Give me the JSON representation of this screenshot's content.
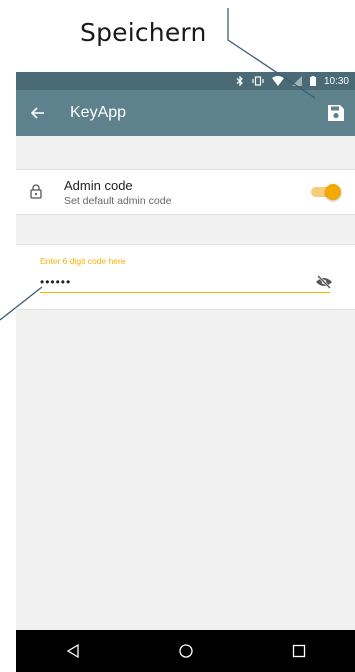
{
  "annotation": {
    "label": "Speichern"
  },
  "statusbar": {
    "time": "10:30",
    "icons": [
      "bluetooth-icon",
      "vibrate-icon",
      "wifi-icon",
      "signal-icon",
      "battery-icon"
    ]
  },
  "appbar": {
    "title": "KeyApp",
    "back_icon": "arrow-left-icon",
    "save_icon": "save-icon"
  },
  "admin_code": {
    "title": "Admin code",
    "subtitle": "Set default admin code",
    "toggle_on": true,
    "icon": "lock-icon"
  },
  "code_field": {
    "label": "Enter 6 digit code here",
    "value": "••••••",
    "visibility_icon": "eye-off-icon"
  },
  "navbar": {
    "icons": [
      "back-triangle-icon",
      "home-circle-icon",
      "recents-square-icon"
    ]
  },
  "colors": {
    "accent": "#F5A800",
    "appbar": "#5E828D",
    "statusbar": "#4A6A75",
    "annotation_line": "#3A5F75"
  }
}
